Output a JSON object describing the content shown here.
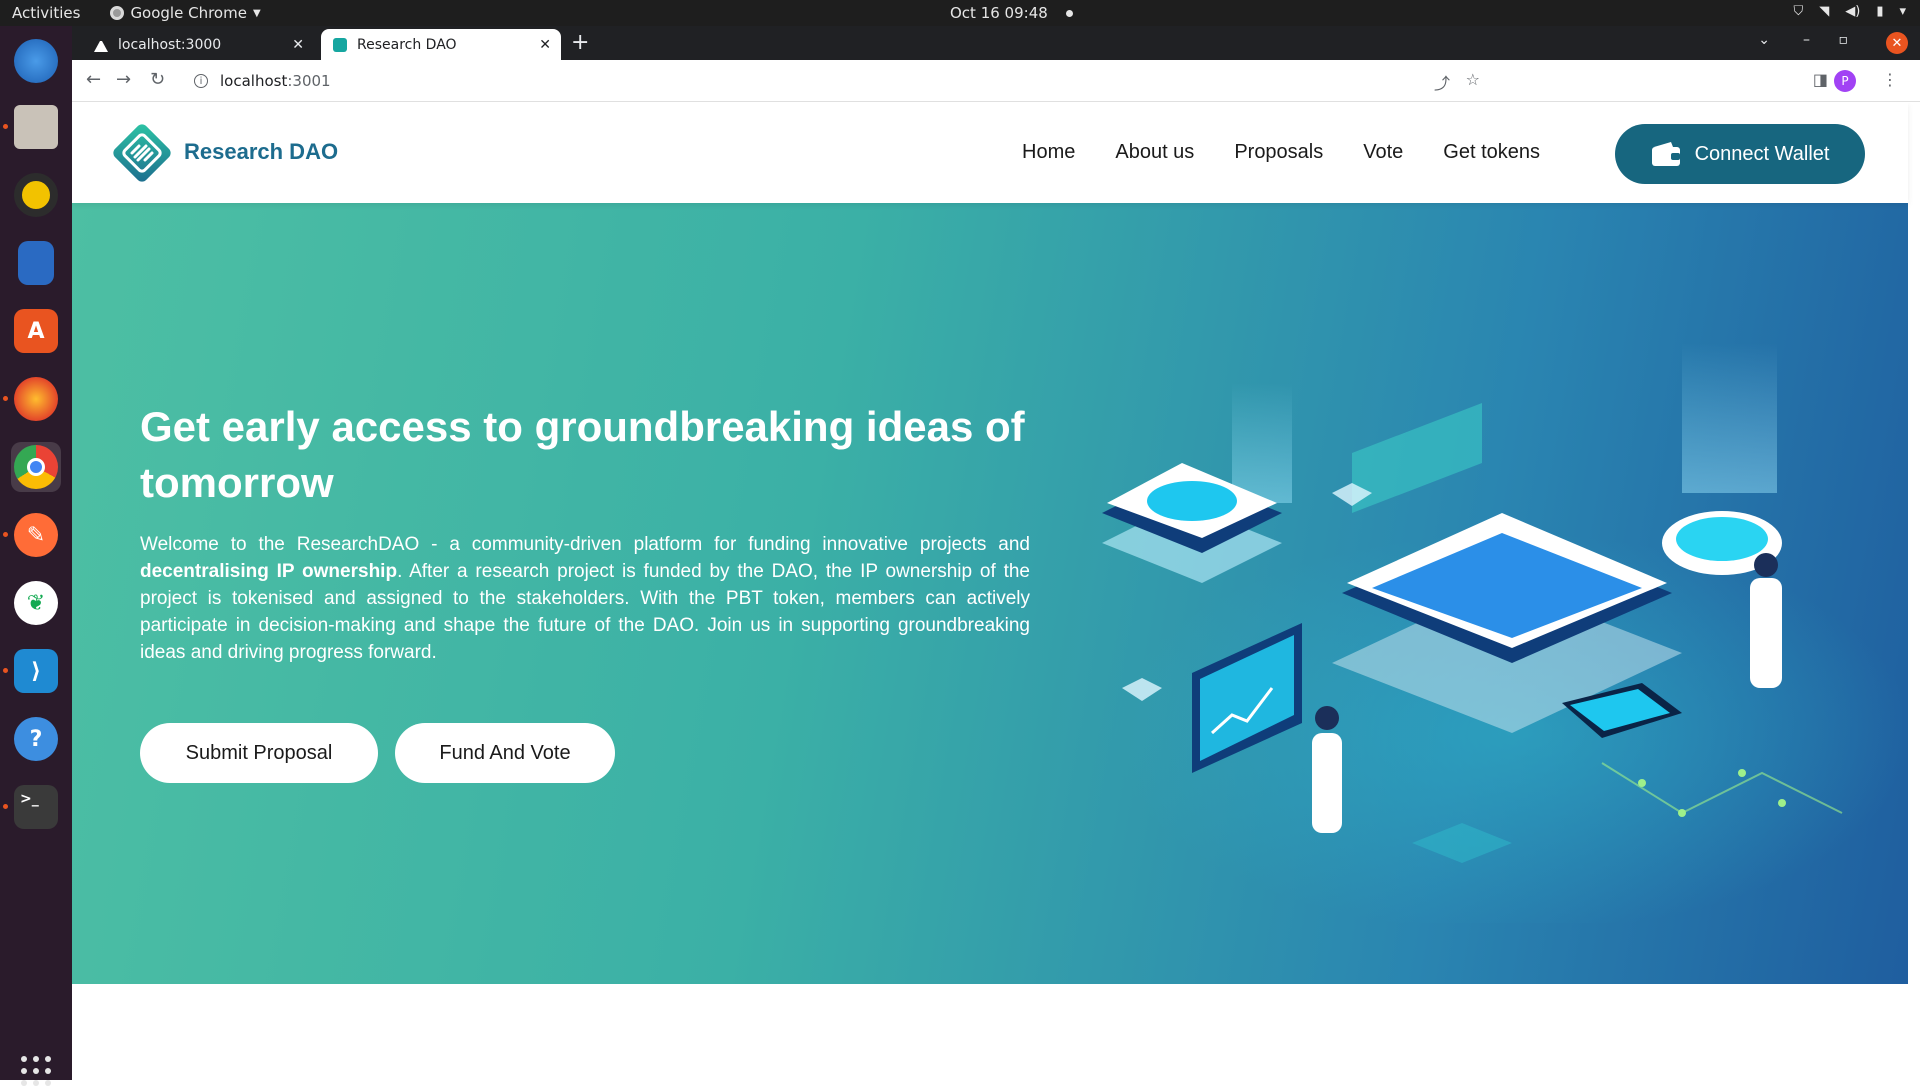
{
  "os": {
    "activities": "Activities",
    "app_name": "Google Chrome",
    "clock": "Oct 16  09:48"
  },
  "browser": {
    "tabs": [
      {
        "title": "localhost:3000"
      },
      {
        "title": "Research DAO"
      }
    ],
    "url_host": "localhost",
    "url_port": ":3001",
    "profile_initial": "P"
  },
  "site": {
    "brand": "Research DAO",
    "nav": [
      "Home",
      "About us",
      "Proposals",
      "Vote",
      "Get tokens"
    ],
    "connect_wallet": "Connect Wallet",
    "accent_color": "#17667f"
  },
  "hero": {
    "title": "Get early access to groundbreaking ideas of tomorrow",
    "text_before": "Welcome to the ResearchDAO - a community-driven platform for funding innovative projects and ",
    "text_bold": "decentralising IP ownership",
    "text_after": ". After a research project is funded by the DAO, the IP ownership of the project is tokenised and assigned to the stakeholders. With the PBT token, members can actively participate in decision-making and shape the future of the DAO. Join us in supporting groundbreaking ideas and driving progress forward.",
    "buttons": [
      "Submit Proposal",
      "Fund And Vote"
    ],
    "gradient": [
      "#4dbfa3",
      "#1f5e9f"
    ]
  }
}
